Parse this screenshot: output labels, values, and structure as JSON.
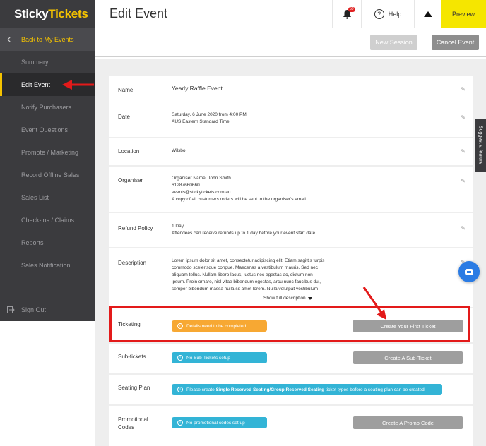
{
  "logo": {
    "part1": "Sticky",
    "part2": "Tickets"
  },
  "sidebar": {
    "back_label": "Back to My Events",
    "items": [
      {
        "label": "Summary"
      },
      {
        "label": "Edit Event"
      },
      {
        "label": "Notify Purchasers"
      },
      {
        "label": "Event Questions"
      },
      {
        "label": "Promote / Marketing"
      },
      {
        "label": "Record Offline Sales"
      },
      {
        "label": "Sales List"
      },
      {
        "label": "Check-ins / Claims"
      },
      {
        "label": "Reports"
      },
      {
        "label": "Sales Notification"
      }
    ],
    "signout_label": "Sign Out"
  },
  "header": {
    "title": "Edit Event",
    "notification_count": "50",
    "help_label": "Help",
    "preview_label": "Preview"
  },
  "actions": {
    "new_session": "New Session",
    "cancel_event": "Cancel Event"
  },
  "fields": {
    "name": {
      "label": "Name",
      "value": "Yearly Raffle Event"
    },
    "date": {
      "label": "Date",
      "line1": "Saturday, 6 June 2020 from 4:00 PM",
      "line2": "AUS Eastern Standard Time"
    },
    "location": {
      "label": "Location",
      "value": "Wilsbo"
    },
    "organiser": {
      "label": "Organiser",
      "line1": "Organiser Name, John Smith",
      "line2": "61287660660",
      "line3": "events@stickytickets.com.au",
      "line4": "A copy of all customers orders will be sent to the organiser's email"
    },
    "refund": {
      "label": "Refund Policy",
      "line1": "1 Day",
      "line2": "Attendees can receive refunds up to 1 day before your event start date."
    },
    "description": {
      "label": "Description",
      "line1": "Lorem ipsum dolor sit amet, consectetur adipiscing elit. Etiam sagittis turpis",
      "line2": "commodo scelerisque congue. Maecenas a vestibulum mauris. Sed nec",
      "line3": "aliquam tellus. Nullam libero lacus, luctus nec egestas ac, dictum non",
      "line4": "ipsum. Proin ornare, nisl vitae bibendum egestas, arcu nunc faucibus dui,",
      "line5": "semper bibendum massa nulla sit amet lorem. Nulla volutpat vestibulum",
      "show_full": "Show full description"
    },
    "ticketing": {
      "label": "Ticketing",
      "status": "Details need to be completed",
      "button": "Create Your First Ticket"
    },
    "subtickets": {
      "label": "Sub-tickets",
      "status": "No Sub-Tickets setup",
      "button": "Create A Sub-Ticket"
    },
    "seating": {
      "label": "Seating Plan",
      "status_pre": "Please create ",
      "status_bold": "Single Reserved Seating/Group Reserved Seating",
      "status_post": " ticket types before a seating plan can be created"
    },
    "promo": {
      "label1": "Promotional",
      "label2": "Codes",
      "status": "No promotional codes set up",
      "button": "Create A Promo Code"
    }
  },
  "floating": {
    "suggest": "Suggest a feature"
  },
  "colors": {
    "brand_yellow": "#f5c300",
    "preview_yellow": "#f5e600",
    "annotation_red": "#e31a1a",
    "info_blue": "#33b4d6",
    "warning_orange": "#f7a833"
  }
}
